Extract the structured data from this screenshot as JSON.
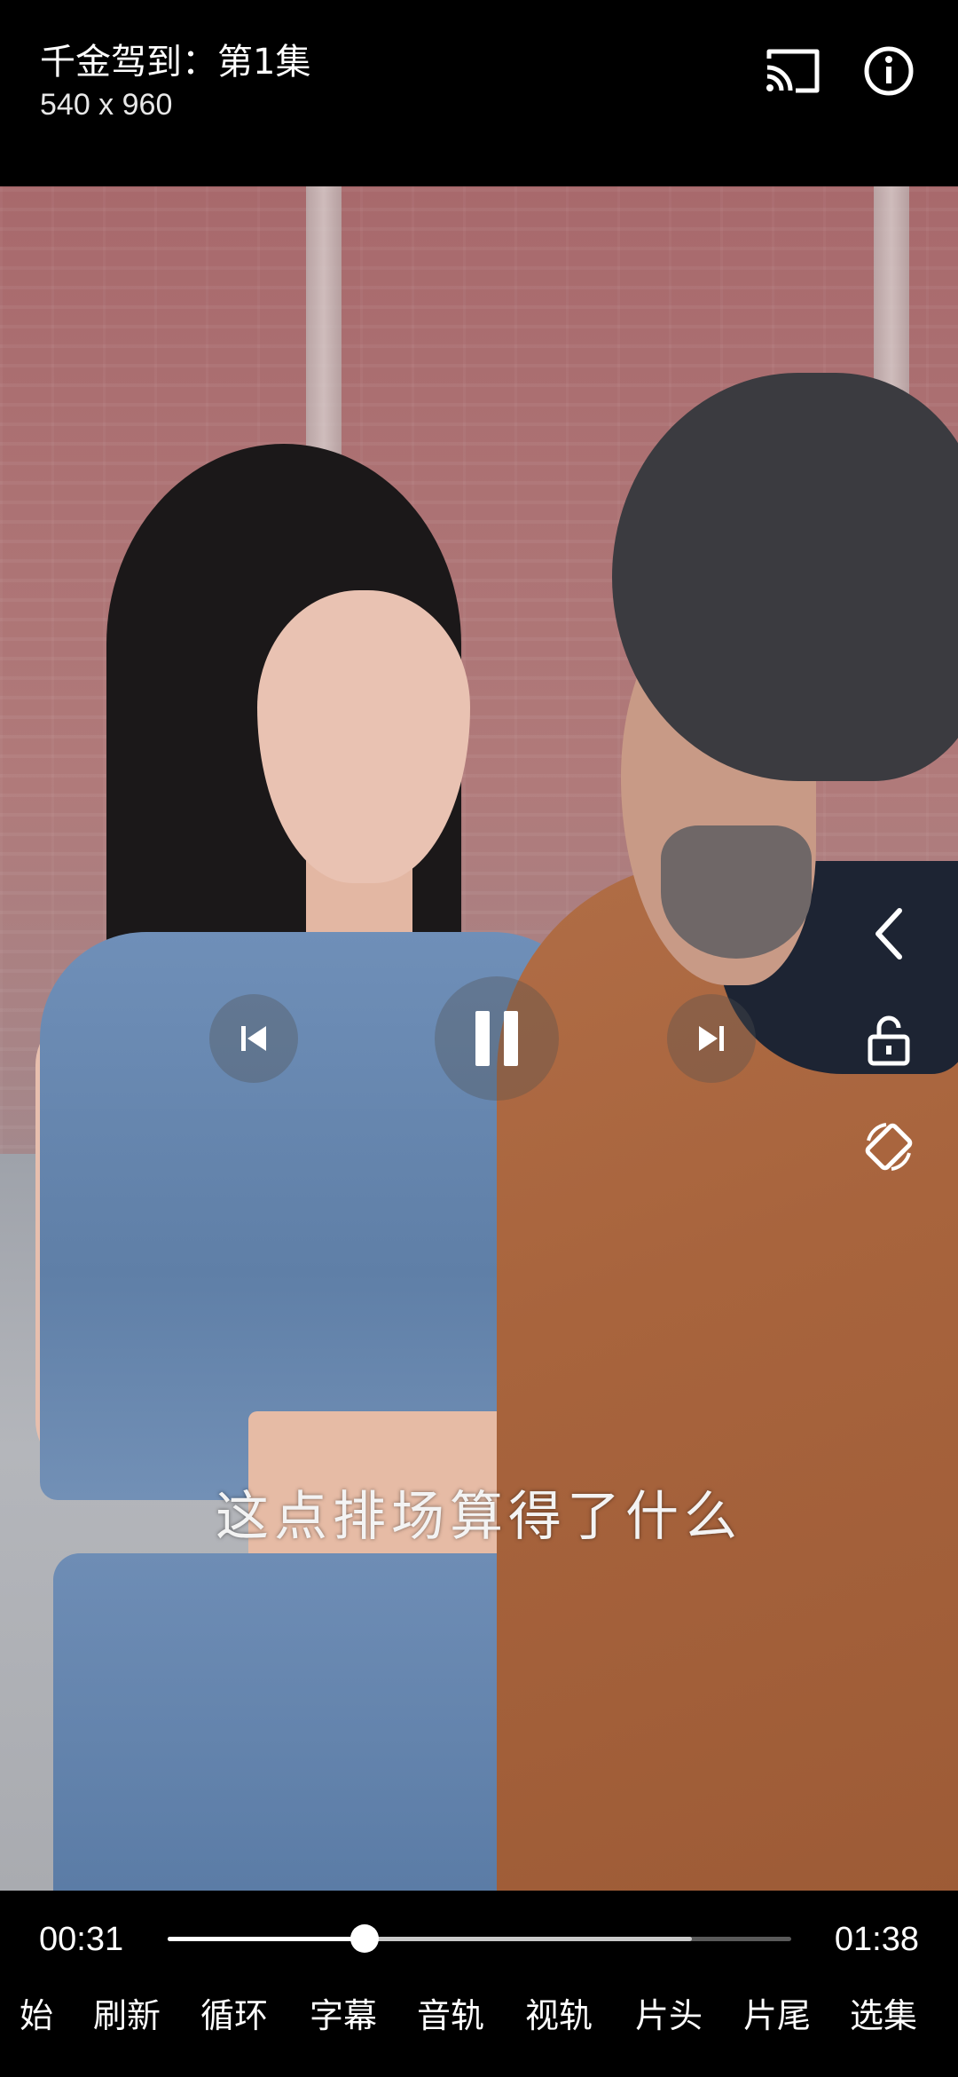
{
  "header": {
    "title": "千金驾到：第1集",
    "resolution": "540 x 960",
    "cast_icon": "cast-icon",
    "info_icon": "info-icon"
  },
  "video": {
    "subtitle": "这点排场算得了什么"
  },
  "controls": {
    "prev_icon": "skip-previous-icon",
    "play_pause_icon": "pause-icon",
    "next_icon": "skip-next-icon",
    "side": [
      "back-chevron-icon",
      "lock-icon",
      "screen-rotate-icon"
    ]
  },
  "player": {
    "current_time": "00:31",
    "total_time": "01:38",
    "progress_fraction": 0.316,
    "buffered_fraction": 0.84
  },
  "menu": {
    "items": [
      "始",
      "刷新",
      "循环",
      "字幕",
      "音轨",
      "视轨",
      "片头",
      "片尾",
      "选集"
    ]
  }
}
